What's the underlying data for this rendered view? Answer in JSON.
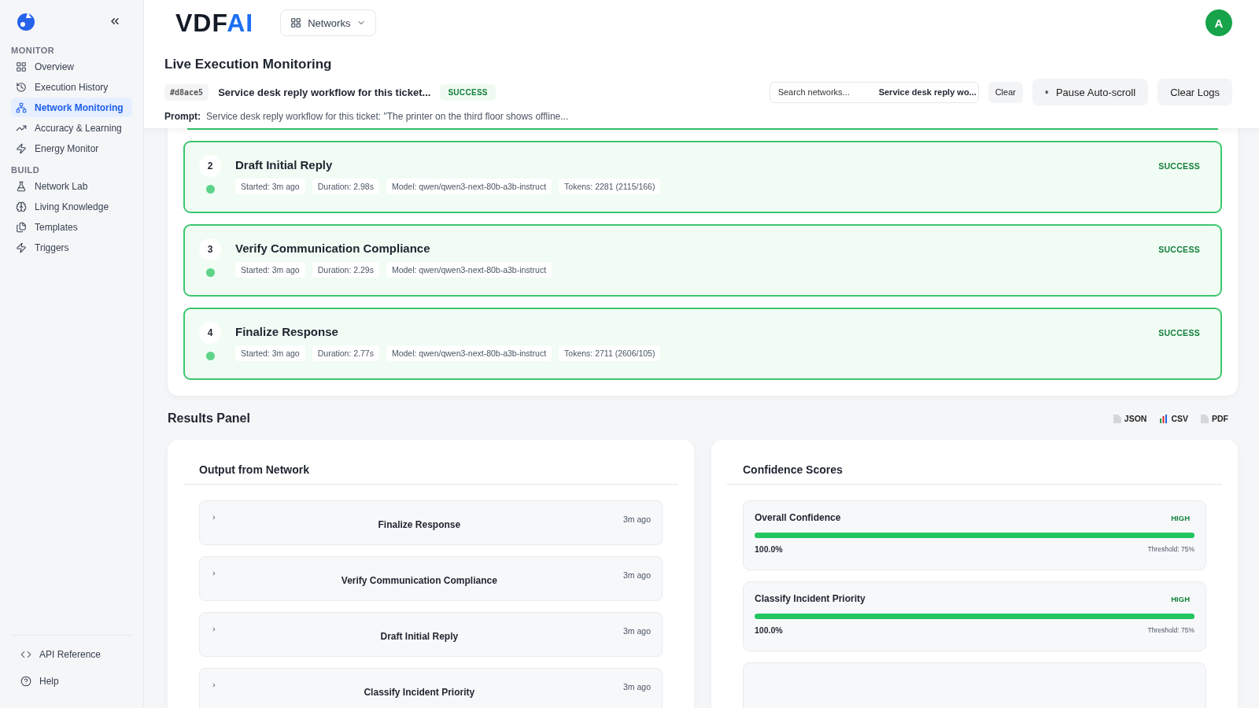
{
  "sidebar": {
    "sections": [
      {
        "title": "MONITOR",
        "items": [
          {
            "label": "Overview",
            "selected": false
          },
          {
            "label": "Execution History",
            "selected": false
          },
          {
            "label": "Network Monitoring",
            "selected": true
          },
          {
            "label": "Accuracy & Learning",
            "selected": false
          },
          {
            "label": "Energy Monitor",
            "selected": false
          }
        ]
      },
      {
        "title": "BUILD",
        "items": [
          {
            "label": "Network Lab",
            "selected": false
          },
          {
            "label": "Living Knowledge",
            "selected": false
          },
          {
            "label": "Templates",
            "selected": false
          },
          {
            "label": "Triggers",
            "selected": false
          }
        ]
      }
    ],
    "footer": [
      {
        "label": "API Reference"
      },
      {
        "label": "Help"
      }
    ]
  },
  "topbar": {
    "logo": "VDFAI",
    "networks_button": "Networks",
    "avatar": "A"
  },
  "header": {
    "title": "Live Execution Monitoring",
    "run_id": "#d8ace5",
    "run_name": "Service desk reply workflow for this ticket...",
    "status": "SUCCESS",
    "prompt_label": "Prompt:",
    "prompt": "Service desk reply workflow for this ticket: \"The printer on the third floor shows offline...",
    "search": {
      "placeholder": "Search networks...",
      "value": "Service desk reply wo..."
    },
    "clear_button": "Clear",
    "pause_button": {
      "icon": "⏸",
      "label": "Pause Auto-scroll"
    },
    "clear_logs_button": "Clear Logs"
  },
  "steps": [
    {
      "number": "2",
      "title": "Draft Initial Reply",
      "status": "SUCCESS",
      "meta": [
        "Started: 3m ago",
        "Duration: 2.98s",
        "Model: qwen/qwen3-next-80b-a3b-instruct",
        "Tokens: 2281 (2115/166)"
      ]
    },
    {
      "number": "3",
      "title": "Verify Communication Compliance",
      "status": "SUCCESS",
      "meta": [
        "Started: 3m ago",
        "Duration: 2.29s",
        "Model: qwen/qwen3-next-80b-a3b-instruct"
      ]
    },
    {
      "number": "4",
      "title": "Finalize Response",
      "status": "SUCCESS",
      "meta": [
        "Started: 3m ago",
        "Duration: 2.77s",
        "Model: qwen/qwen3-next-80b-a3b-instruct",
        "Tokens: 2711 (2606/105)"
      ]
    }
  ],
  "results": {
    "title": "Results Panel",
    "exports": [
      {
        "kind": "file",
        "label": "JSON"
      },
      {
        "kind": "chart",
        "label": "CSV"
      },
      {
        "kind": "file",
        "label": "PDF"
      }
    ],
    "output": {
      "title": "Output from Network",
      "items": [
        {
          "chevron": "›",
          "title": "Finalize Response",
          "time": "3m ago"
        },
        {
          "chevron": "›",
          "title": "Verify Communication Compliance",
          "time": "3m ago"
        },
        {
          "chevron": "›",
          "title": "Draft Initial Reply",
          "time": "3m ago"
        },
        {
          "chevron": "›",
          "title": "Classify Incident Priority",
          "time": "3m ago"
        }
      ]
    },
    "confidence": {
      "title": "Confidence Scores",
      "items": [
        {
          "name": "Overall Confidence",
          "badge": "HIGH",
          "level": 1.0,
          "value": "100.0%",
          "threshold": "Threshold: 75%"
        },
        {
          "name": "Classify Incident Priority",
          "badge": "HIGH",
          "level": 1.0,
          "value": "100.0%",
          "threshold": "Threshold: 75%"
        }
      ]
    }
  }
}
